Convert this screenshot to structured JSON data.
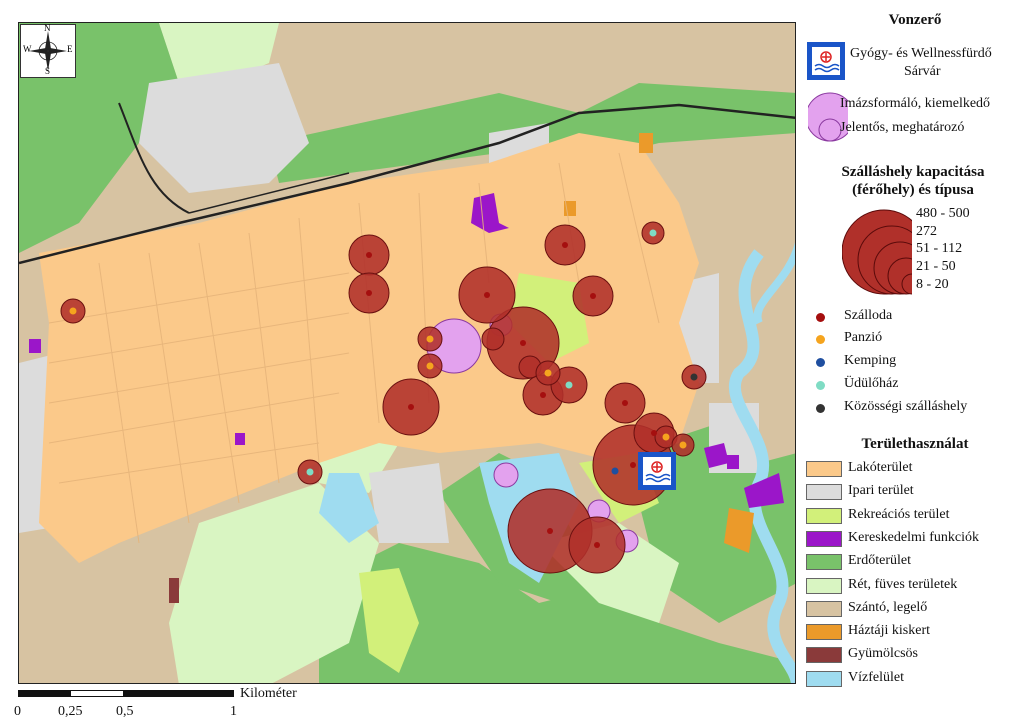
{
  "legend": {
    "attraction_title": "Vonzerő",
    "spa_line1": "Gyógy- és Wellnessfürdő",
    "spa_line2": "Sárvár",
    "image_shaping": "Imázsformáló, kiemelkedő",
    "significant": "Jelentős, meghatározó",
    "capacity_title_line1": "Szálláshely kapacitása",
    "capacity_title_line2": "(férőhely) és típusa",
    "capacity_classes": [
      "480 - 500",
      "272",
      "51 - 112",
      "21 - 50",
      "8 - 20"
    ],
    "types": [
      {
        "label": "Szálloda",
        "color": "#a50f0f"
      },
      {
        "label": "Panzió",
        "color": "#f5a41e"
      },
      {
        "label": "Kemping",
        "color": "#1f4fa0"
      },
      {
        "label": "Üdülőház",
        "color": "#7fdcc4"
      },
      {
        "label": "Közösségi szálláshely",
        "color": "#333333"
      }
    ],
    "landuse_title": "Területhasználat",
    "landuse": [
      {
        "label": "Lakóterület",
        "color": "#fbc98a"
      },
      {
        "label": "Ipari terület",
        "color": "#dcdcdc"
      },
      {
        "label": "Rekreációs terület",
        "color": "#d2f07a"
      },
      {
        "label": "Kereskedelmi funkciók",
        "color": "#9b16c9"
      },
      {
        "label": "Erdőterület",
        "color": "#79c26a"
      },
      {
        "label": "Rét, füves területek",
        "color": "#d9f5c2"
      },
      {
        "label": "Szántó, legelő",
        "color": "#d7c3a2"
      },
      {
        "label": "Háztáji kiskert",
        "color": "#eb9a2a"
      },
      {
        "label": "Gyümölcsös",
        "color": "#8a3a3a"
      },
      {
        "label": "Vízfelület",
        "color": "#9fdcf0"
      }
    ]
  },
  "scale": {
    "unit": "Kilométer",
    "ticks": [
      "0",
      "0,25",
      "0,5",
      "1"
    ]
  },
  "compass": {
    "n": "N",
    "s": "S",
    "e": "E",
    "w": "W"
  }
}
